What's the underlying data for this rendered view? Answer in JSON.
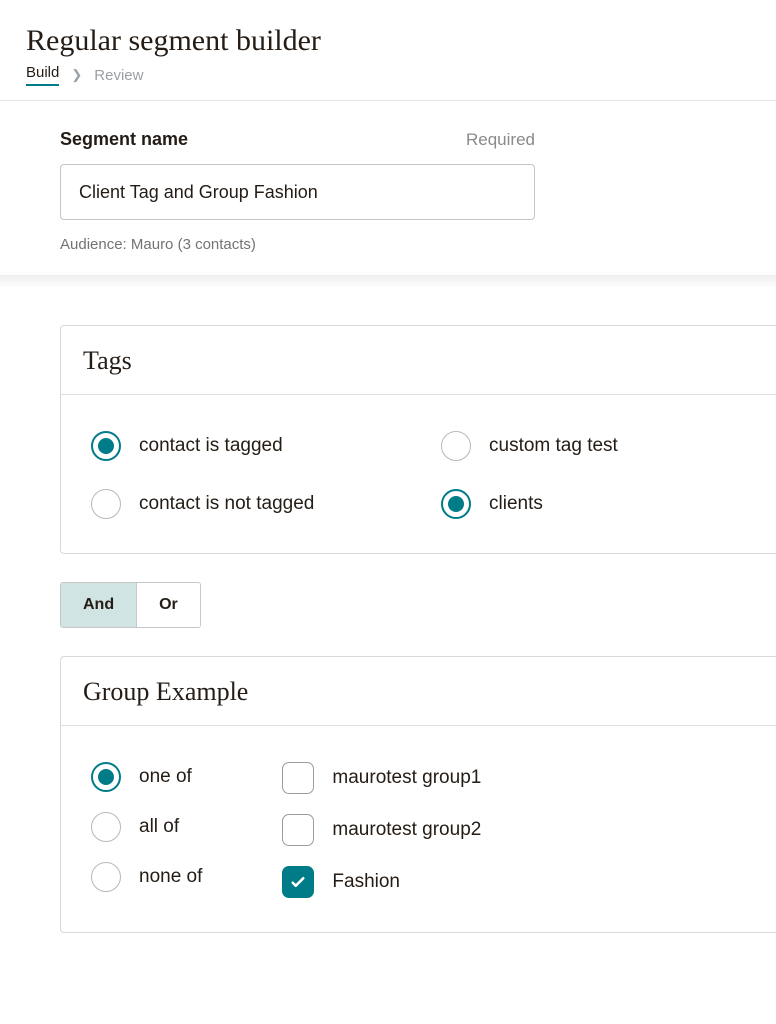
{
  "header": {
    "title": "Regular segment builder",
    "breadcrumb": {
      "build": "Build",
      "review": "Review"
    }
  },
  "segment_name": {
    "label": "Segment name",
    "required_label": "Required",
    "value": "Client Tag and Group Fashion",
    "audience_line": "Audience: Mauro (3 contacts)"
  },
  "tags_panel": {
    "title": "Tags",
    "left_options": [
      {
        "label": "contact is tagged",
        "selected": true
      },
      {
        "label": "contact is not tagged",
        "selected": false
      }
    ],
    "right_options": [
      {
        "label": "custom tag test",
        "selected": false
      },
      {
        "label": "clients",
        "selected": true
      }
    ]
  },
  "logic": {
    "and": "And",
    "or": "Or",
    "active": "and"
  },
  "group_panel": {
    "title": "Group Example",
    "qualifier_options": [
      {
        "label": "one of",
        "selected": true
      },
      {
        "label": "all of",
        "selected": false
      },
      {
        "label": "none of",
        "selected": false
      }
    ],
    "group_options": [
      {
        "label": "maurotest group1",
        "checked": false
      },
      {
        "label": "maurotest group2",
        "checked": false
      },
      {
        "label": "Fashion",
        "checked": true
      }
    ]
  }
}
